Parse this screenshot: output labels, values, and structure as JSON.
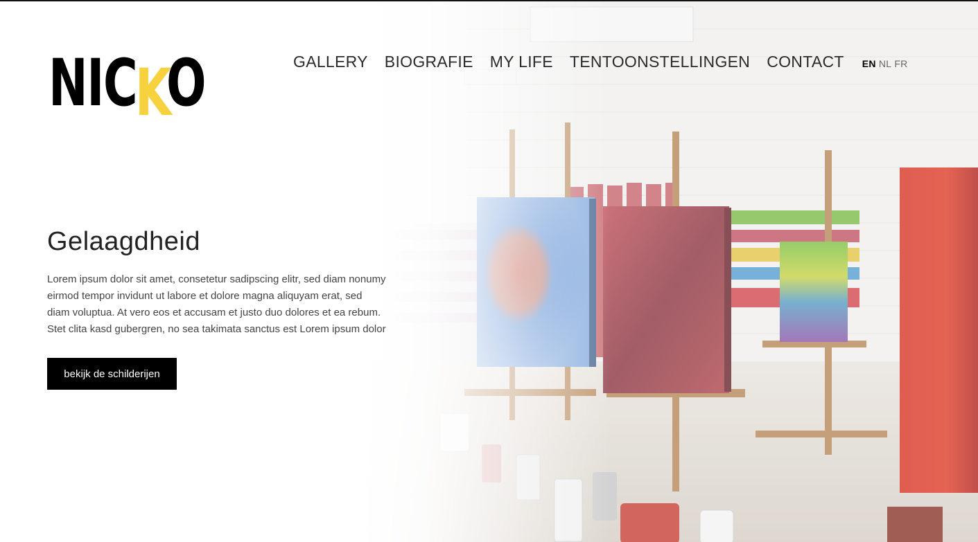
{
  "brand": {
    "logo_left": "NIC",
    "logo_accent": "K",
    "logo_right": "O",
    "accent_color": "#f7d23e"
  },
  "nav": {
    "items": [
      {
        "label": "GALLERY"
      },
      {
        "label": "BIOGRAFIE"
      },
      {
        "label": "MY LIFE"
      },
      {
        "label": "TENTOONSTELLINGEN"
      },
      {
        "label": "CONTACT"
      }
    ],
    "languages": [
      {
        "label": "EN",
        "active": true
      },
      {
        "label": "NL",
        "active": false
      },
      {
        "label": "FR",
        "active": false
      }
    ]
  },
  "hero": {
    "title": "Gelaagdheid",
    "body_lines": [
      "Lorem ipsum dolor sit amet, consetetur sadipscing elitr, sed diam nonumy",
      "eirmod tempor invidunt ut labore et dolore magna aliquyam erat, sed",
      "diam voluptua. At vero eos et accusam et justo duo dolores et ea rebum.",
      "Stet clita kasd gubergren, no sea takimata sanctus est Lorem ipsum dolor"
    ],
    "button_label": "bekijk de schilderijen",
    "background_image": "artist-studio-with-easels-and-paintings"
  }
}
